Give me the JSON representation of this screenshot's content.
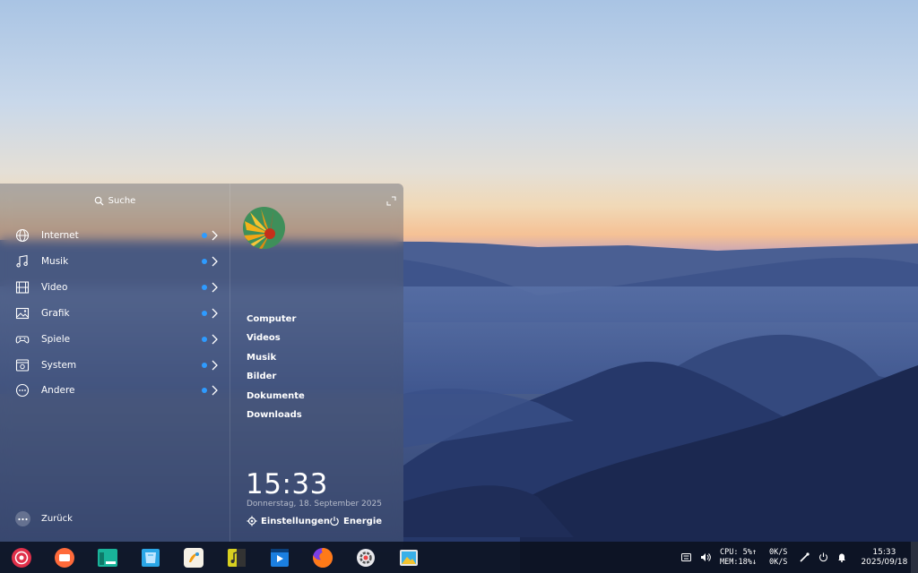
{
  "launcher": {
    "search_label": "Suche",
    "categories": [
      {
        "label": "Internet",
        "icon": "globe-icon"
      },
      {
        "label": "Musik",
        "icon": "music-icon"
      },
      {
        "label": "Video",
        "icon": "film-icon"
      },
      {
        "label": "Grafik",
        "icon": "image-icon"
      },
      {
        "label": "Spiele",
        "icon": "gamepad-icon"
      },
      {
        "label": "System",
        "icon": "system-icon"
      },
      {
        "label": "Andere",
        "icon": "more-icon"
      }
    ],
    "back_label": "Zurück",
    "places": [
      "Computer",
      "Videos",
      "Musik",
      "Bilder",
      "Dokumente",
      "Downloads"
    ],
    "time": "15:33",
    "date": "Donnerstag, 18. September 2025",
    "settings_label": "Einstellungen",
    "power_label": "Energie"
  },
  "dock": {
    "apps": [
      {
        "name": "launcher-icon",
        "color": "#e0304a"
      },
      {
        "name": "multitasking-icon",
        "color": "#ff6a3a"
      },
      {
        "name": "file-manager-icon",
        "color": "#19b39a"
      },
      {
        "name": "app-store-icon",
        "color": "#2aa6e6"
      },
      {
        "name": "draw-icon",
        "color": "#f5f0e6"
      },
      {
        "name": "music-player-icon",
        "color": "#d8d020"
      },
      {
        "name": "video-player-icon",
        "color": "#1b7fe0"
      },
      {
        "name": "firefox-icon",
        "color": "#ff7a18"
      },
      {
        "name": "settings-icon",
        "color": "#e8e8ec"
      },
      {
        "name": "image-viewer-icon",
        "color": "#3ab0e8"
      }
    ],
    "tray": {
      "cpu": "CPU: 5%↑",
      "mem": "MEM:18%↓",
      "net_up": "0K/S",
      "net_down": "0K/S",
      "time": "15:33",
      "date": "2025/09/18"
    }
  },
  "colors": {
    "accent_dot": "#2e9bff",
    "dock_bg": "#0c121e"
  }
}
